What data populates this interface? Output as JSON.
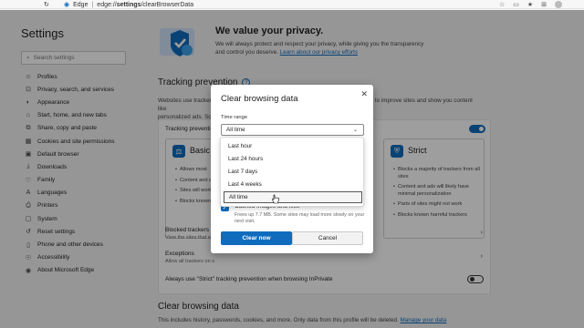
{
  "browser": {
    "tab_label": "Edge",
    "url_prefix": "edge://",
    "url_bold": "settings",
    "url_rest": "/clearBrowserData"
  },
  "sidebar": {
    "title": "Settings",
    "search_placeholder": "Search settings",
    "items": [
      {
        "label": "Profiles",
        "icon": "profile-icon"
      },
      {
        "label": "Privacy, search, and services",
        "icon": "lock-icon"
      },
      {
        "label": "Appearance",
        "icon": "appearance-icon"
      },
      {
        "label": "Start, home, and new tabs",
        "icon": "home-icon"
      },
      {
        "label": "Share, copy and paste",
        "icon": "share-icon"
      },
      {
        "label": "Cookies and site permissions",
        "icon": "cookie-icon"
      },
      {
        "label": "Default browser",
        "icon": "browser-icon"
      },
      {
        "label": "Downloads",
        "icon": "download-icon"
      },
      {
        "label": "Family",
        "icon": "family-icon"
      },
      {
        "label": "Languages",
        "icon": "language-icon"
      },
      {
        "label": "Printers",
        "icon": "printer-icon"
      },
      {
        "label": "System",
        "icon": "system-icon"
      },
      {
        "label": "Reset settings",
        "icon": "reset-icon"
      },
      {
        "label": "Phone and other devices",
        "icon": "phone-icon"
      },
      {
        "label": "Accessibility",
        "icon": "accessibility-icon"
      },
      {
        "label": "About Microsoft Edge",
        "icon": "edge-icon"
      }
    ]
  },
  "privacy": {
    "title": "We value your privacy.",
    "desc": "We will always protect and respect your privacy, while giving you the transparency and control you deserve.",
    "link": "Learn about our privacy efforts"
  },
  "tracking": {
    "title": "Tracking prevention",
    "desc_start": "Websites use trackers",
    "desc_end": "to improve sites and show you content like",
    "desc_line2": "personalized ads. Som",
    "row_label": "Tracking preventio",
    "basic": {
      "name": "Basic",
      "bullets": [
        "Allows most",
        "Content and ads personalized",
        "Sites will work",
        "Blocks known h"
      ]
    },
    "strict": {
      "name": "Strict",
      "bullets": [
        "Blocks a majority of trackers from all sites",
        "Content and ads will likely have minimal personalization",
        "Parts of sites might not work",
        "Blocks known harmful trackers"
      ]
    },
    "blocked_title": "Blocked trackers",
    "blocked_desc": "View the sites that we",
    "exceptions_title": "Exceptions",
    "exceptions_desc": "Allow all trackers on s",
    "inprivate_label": "Always use \"Strict\" tracking prevention when browsing InPrivate"
  },
  "clear": {
    "title": "Clear browsing data",
    "desc": "This includes history, passwords, cookies, and more. Only data from this profile will be deleted.",
    "link": "Manage your data"
  },
  "dialog": {
    "title": "Clear browsing data",
    "time_range_label": "Time range",
    "selected": "All time",
    "options": [
      "Last hour",
      "Last 24 hours",
      "Last 7 days",
      "Last 4 weeks",
      "All time"
    ],
    "cached_title": "Cached images and files",
    "cached_desc": "Frees up 7.7 MB. Some sites may load more slowly on your next visit.",
    "clear_button": "Clear now",
    "cancel_button": "Cancel"
  },
  "colors": {
    "accent": "#0f6cbd",
    "background": "#f3f3f3"
  }
}
